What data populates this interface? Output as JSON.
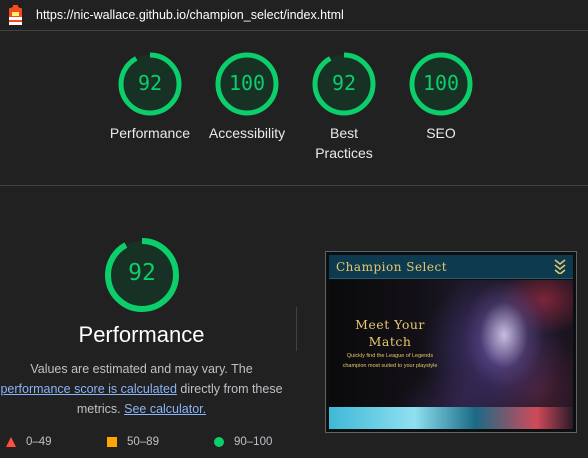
{
  "address_bar": {
    "url": "https://nic-wallace.github.io/champion_select/index.html"
  },
  "summary_gauges": [
    {
      "score": "92",
      "label": "Performance"
    },
    {
      "score": "100",
      "label": "Accessibility"
    },
    {
      "score": "92",
      "label_line1": "Best",
      "label_line2": "Practices"
    },
    {
      "score": "100",
      "label": "SEO"
    }
  ],
  "performance": {
    "score": "92",
    "title": "Performance",
    "desc_part1": "Values are estimated and may vary. The",
    "desc_link1": "performance score is calculated",
    "desc_part2": " directly from these",
    "desc_part3": "metrics.",
    "desc_link2": "See calculator."
  },
  "legend": {
    "fail": "0–49",
    "average": "50–89",
    "pass": "90–100"
  },
  "screenshot": {
    "header_title": "Champion Select",
    "headline_line1": "Meet Your",
    "headline_line2": "Match",
    "sub_line1": "Quickly find the League of Legends",
    "sub_line2": "champion most suited to your playstyle"
  },
  "colors": {
    "pass": "#0cce6b",
    "average": "#ffa400",
    "fail": "#ff4e42",
    "link": "#8ab4f8"
  }
}
